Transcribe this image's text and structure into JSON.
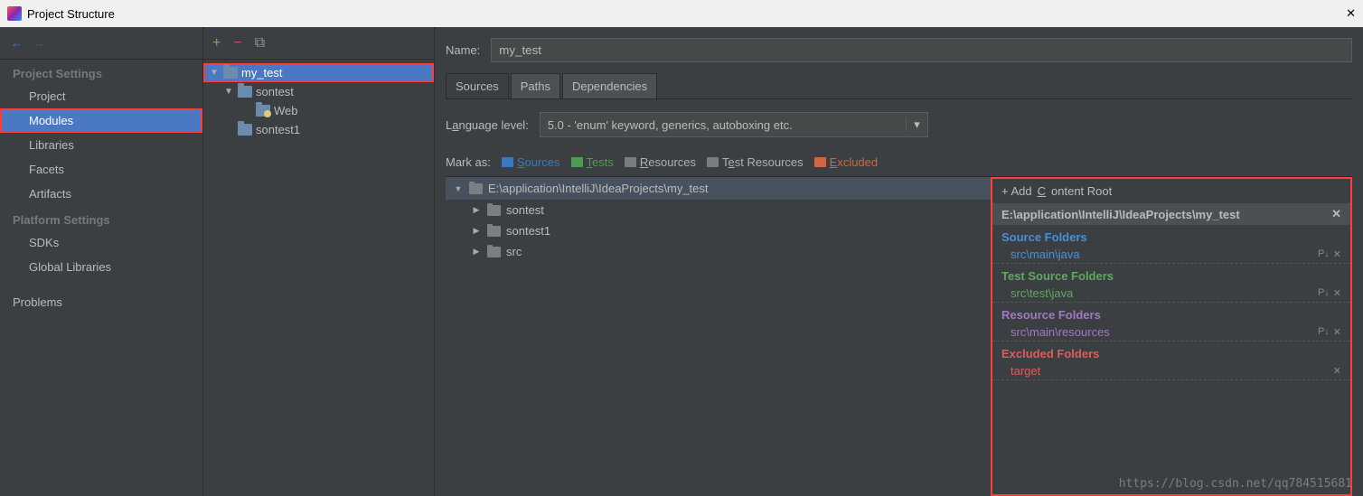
{
  "window": {
    "title": "Project Structure",
    "close": "✕"
  },
  "nav": {
    "back": "←",
    "forward": "→"
  },
  "sidebar": {
    "section1": "Project Settings",
    "items1": [
      "Project",
      "Modules",
      "Libraries",
      "Facets",
      "Artifacts"
    ],
    "section2": "Platform Settings",
    "items2": [
      "SDKs",
      "Global Libraries"
    ],
    "problems": "Problems"
  },
  "moduleToolbar": {
    "add": "+",
    "remove": "−",
    "copy": "⧉"
  },
  "modules": [
    {
      "name": "my_test",
      "level": 0,
      "expanded": true,
      "selected": true,
      "icon": "folder"
    },
    {
      "name": "sontest",
      "level": 1,
      "expanded": true,
      "icon": "folder"
    },
    {
      "name": "Web",
      "level": 2,
      "icon": "web"
    },
    {
      "name": "sontest1",
      "level": 1,
      "icon": "folder"
    }
  ],
  "detail": {
    "nameLabel": "Name:",
    "nameValue": "my_test",
    "tabs": [
      "Sources",
      "Paths",
      "Dependencies"
    ],
    "langLabel_pre": "L",
    "langLabel_u": "a",
    "langLabel_post": "nguage level:",
    "langValue": "5.0 - 'enum' keyword, generics, autoboxing etc.",
    "markAs": "Mark as:",
    "marks": {
      "sources_u": "S",
      "sources_rest": "ources",
      "tests_u": "T",
      "tests_rest": "ests",
      "resources_u": "R",
      "resources_rest": "esources",
      "testres_pre": "T",
      "testres_u": "e",
      "testres_post": "st Resources",
      "excluded_u": "E",
      "excluded_rest": "xcluded"
    },
    "tree": {
      "root": "E:\\application\\IntelliJ\\IdeaProjects\\my_test",
      "children": [
        "sontest",
        "sontest1",
        "src"
      ]
    },
    "contentRoots": {
      "addLabel_pre": "+ Add ",
      "addLabel_u": "C",
      "addLabel_post": "ontent Root",
      "path": "E:\\application\\IntelliJ\\IdeaProjects\\my_test",
      "sections": [
        {
          "title": "Source Folders",
          "cls": "sources",
          "items": [
            "src\\main\\java"
          ],
          "hasP": true
        },
        {
          "title": "Test Source Folders",
          "cls": "tests",
          "items": [
            "src\\test\\java"
          ],
          "hasP": true
        },
        {
          "title": "Resource Folders",
          "cls": "resources",
          "items": [
            "src\\main\\resources"
          ],
          "hasP": true
        },
        {
          "title": "Excluded Folders",
          "cls": "excluded",
          "items": [
            "target"
          ],
          "hasP": false
        }
      ]
    }
  },
  "watermark": "https://blog.csdn.net/qq784515681"
}
